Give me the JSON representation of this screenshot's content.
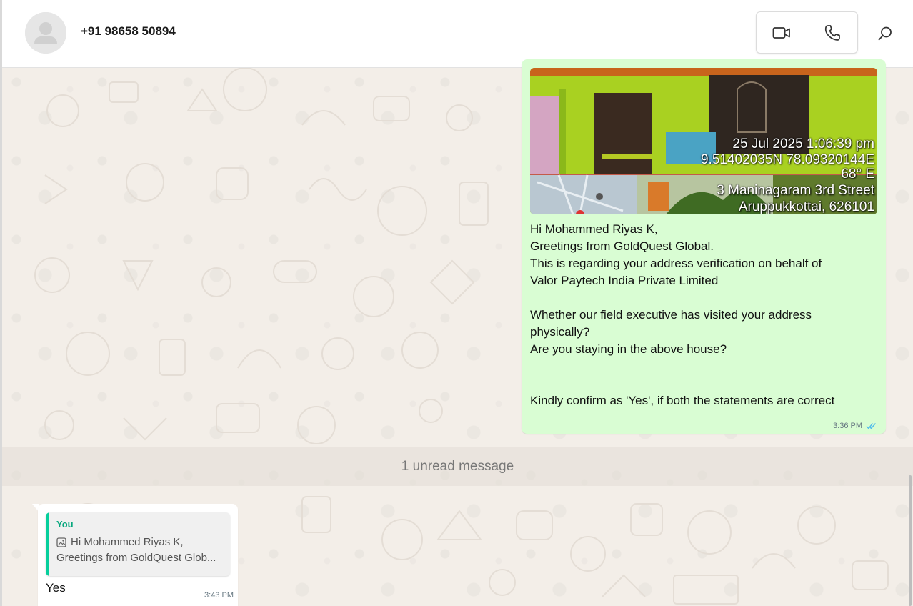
{
  "header": {
    "contact_name": "+91 98658 50894",
    "icons": {
      "avatar": "person-silhouette",
      "video": "video-camera-icon",
      "voice": "phone-icon",
      "search": "search-icon"
    }
  },
  "outgoing_message": {
    "image_stamp": {
      "line1": "25 Jul 2025 1:06:39 pm",
      "line2": "9.51402035N 78.09320144E",
      "line3": "68° E",
      "line4": "3 Maninagaram 3rd Street",
      "line5": "Aruppukkottai, 626101"
    },
    "text": "Hi Mohammed Riyas K,\nGreetings from GoldQuest Global.\nThis is regarding your address verification on behalf of\nValor Paytech India Private Limited\n\nWhether our field executive has visited your address\nphysically?\nAre you staying in the above house?\n\n\nKindly confirm as 'Yes', if both the statements are correct",
    "time": "3:36 PM",
    "status": "read"
  },
  "unread_divider": {
    "label": "1 unread message"
  },
  "incoming_message": {
    "quote": {
      "author": "You",
      "line1": "Hi Mohammed Riyas K,",
      "line2": "Greetings from GoldQuest Glob..."
    },
    "text": "Yes",
    "time": "3:43 PM"
  },
  "colors": {
    "outgoing_bubble": "#d9fdd3",
    "incoming_bubble": "#ffffff",
    "accent_green": "#06cf9c",
    "read_tick": "#53bdeb",
    "wallpaper": "#f3eee8"
  }
}
